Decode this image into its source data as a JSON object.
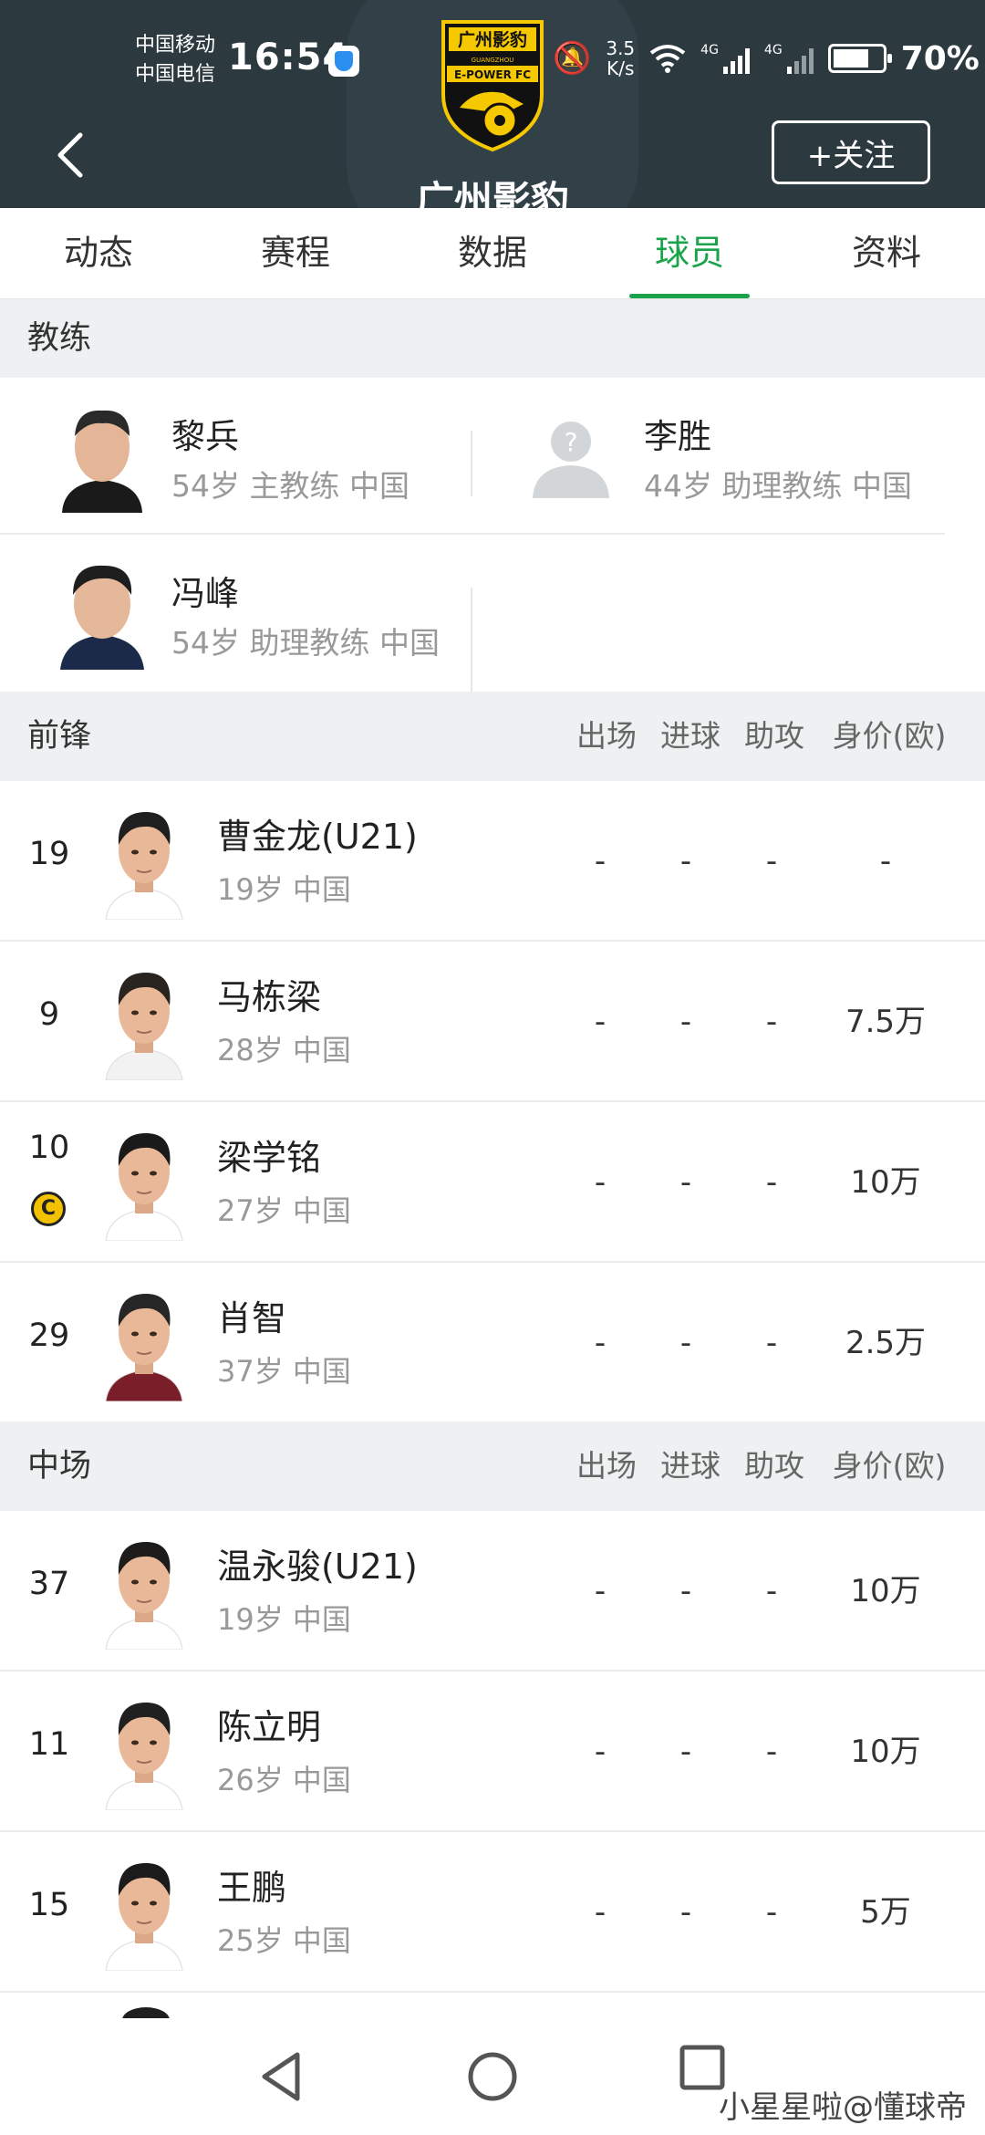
{
  "status_bar": {
    "carrier_1": "中国移动",
    "carrier_2": "中国电信",
    "time": "16:54",
    "speed_value": "3.5",
    "speed_unit": "K/s",
    "battery": "70%",
    "net_1": "4G",
    "net_2": "4G"
  },
  "header": {
    "team_name": "广州影豹",
    "follow_label": "+关注",
    "logo_text_top": "广州影豹",
    "logo_text_bottom": "E-POWER FC",
    "logo_sub": "GUANGZHOU"
  },
  "tabs": [
    {
      "label": "动态",
      "active": false
    },
    {
      "label": "赛程",
      "active": false
    },
    {
      "label": "数据",
      "active": false
    },
    {
      "label": "球员",
      "active": true
    },
    {
      "label": "资料",
      "active": false
    }
  ],
  "coaches_section": {
    "title": "教练",
    "coaches": [
      {
        "name": "黎兵",
        "meta": "54岁 主教练 中国"
      },
      {
        "name": "李胜",
        "meta": "44岁 助理教练 中国"
      },
      {
        "name": "冯峰",
        "meta": "54岁 助理教练 中国"
      }
    ]
  },
  "stat_columns": [
    "出场",
    "进球",
    "助攻",
    "身价(欧)"
  ],
  "forwards": {
    "title": "前锋",
    "players": [
      {
        "number": "19",
        "name": "曹金龙(U21)",
        "meta": "19岁 中国",
        "apps": "-",
        "goals": "-",
        "assists": "-",
        "value": "-",
        "captain": false
      },
      {
        "number": "9",
        "name": "马栋梁",
        "meta": "28岁 中国",
        "apps": "-",
        "goals": "-",
        "assists": "-",
        "value": "7.5万",
        "captain": false
      },
      {
        "number": "10",
        "name": "梁学铭",
        "meta": "27岁 中国",
        "apps": "-",
        "goals": "-",
        "assists": "-",
        "value": "10万",
        "captain": true
      },
      {
        "number": "29",
        "name": "肖智",
        "meta": "37岁 中国",
        "apps": "-",
        "goals": "-",
        "assists": "-",
        "value": "2.5万",
        "captain": false
      }
    ]
  },
  "midfielders": {
    "title": "中场",
    "players": [
      {
        "number": "37",
        "name": "温永骏(U21)",
        "meta": "19岁 中国",
        "apps": "-",
        "goals": "-",
        "assists": "-",
        "value": "10万",
        "captain": false
      },
      {
        "number": "11",
        "name": "陈立明",
        "meta": "26岁 中国",
        "apps": "-",
        "goals": "-",
        "assists": "-",
        "value": "10万",
        "captain": false
      },
      {
        "number": "15",
        "name": "王鹏",
        "meta": "25岁 中国",
        "apps": "-",
        "goals": "-",
        "assists": "-",
        "value": "5万",
        "captain": false
      }
    ]
  },
  "captain_badge": "C",
  "watermark": "小星星啦@懂球帝"
}
